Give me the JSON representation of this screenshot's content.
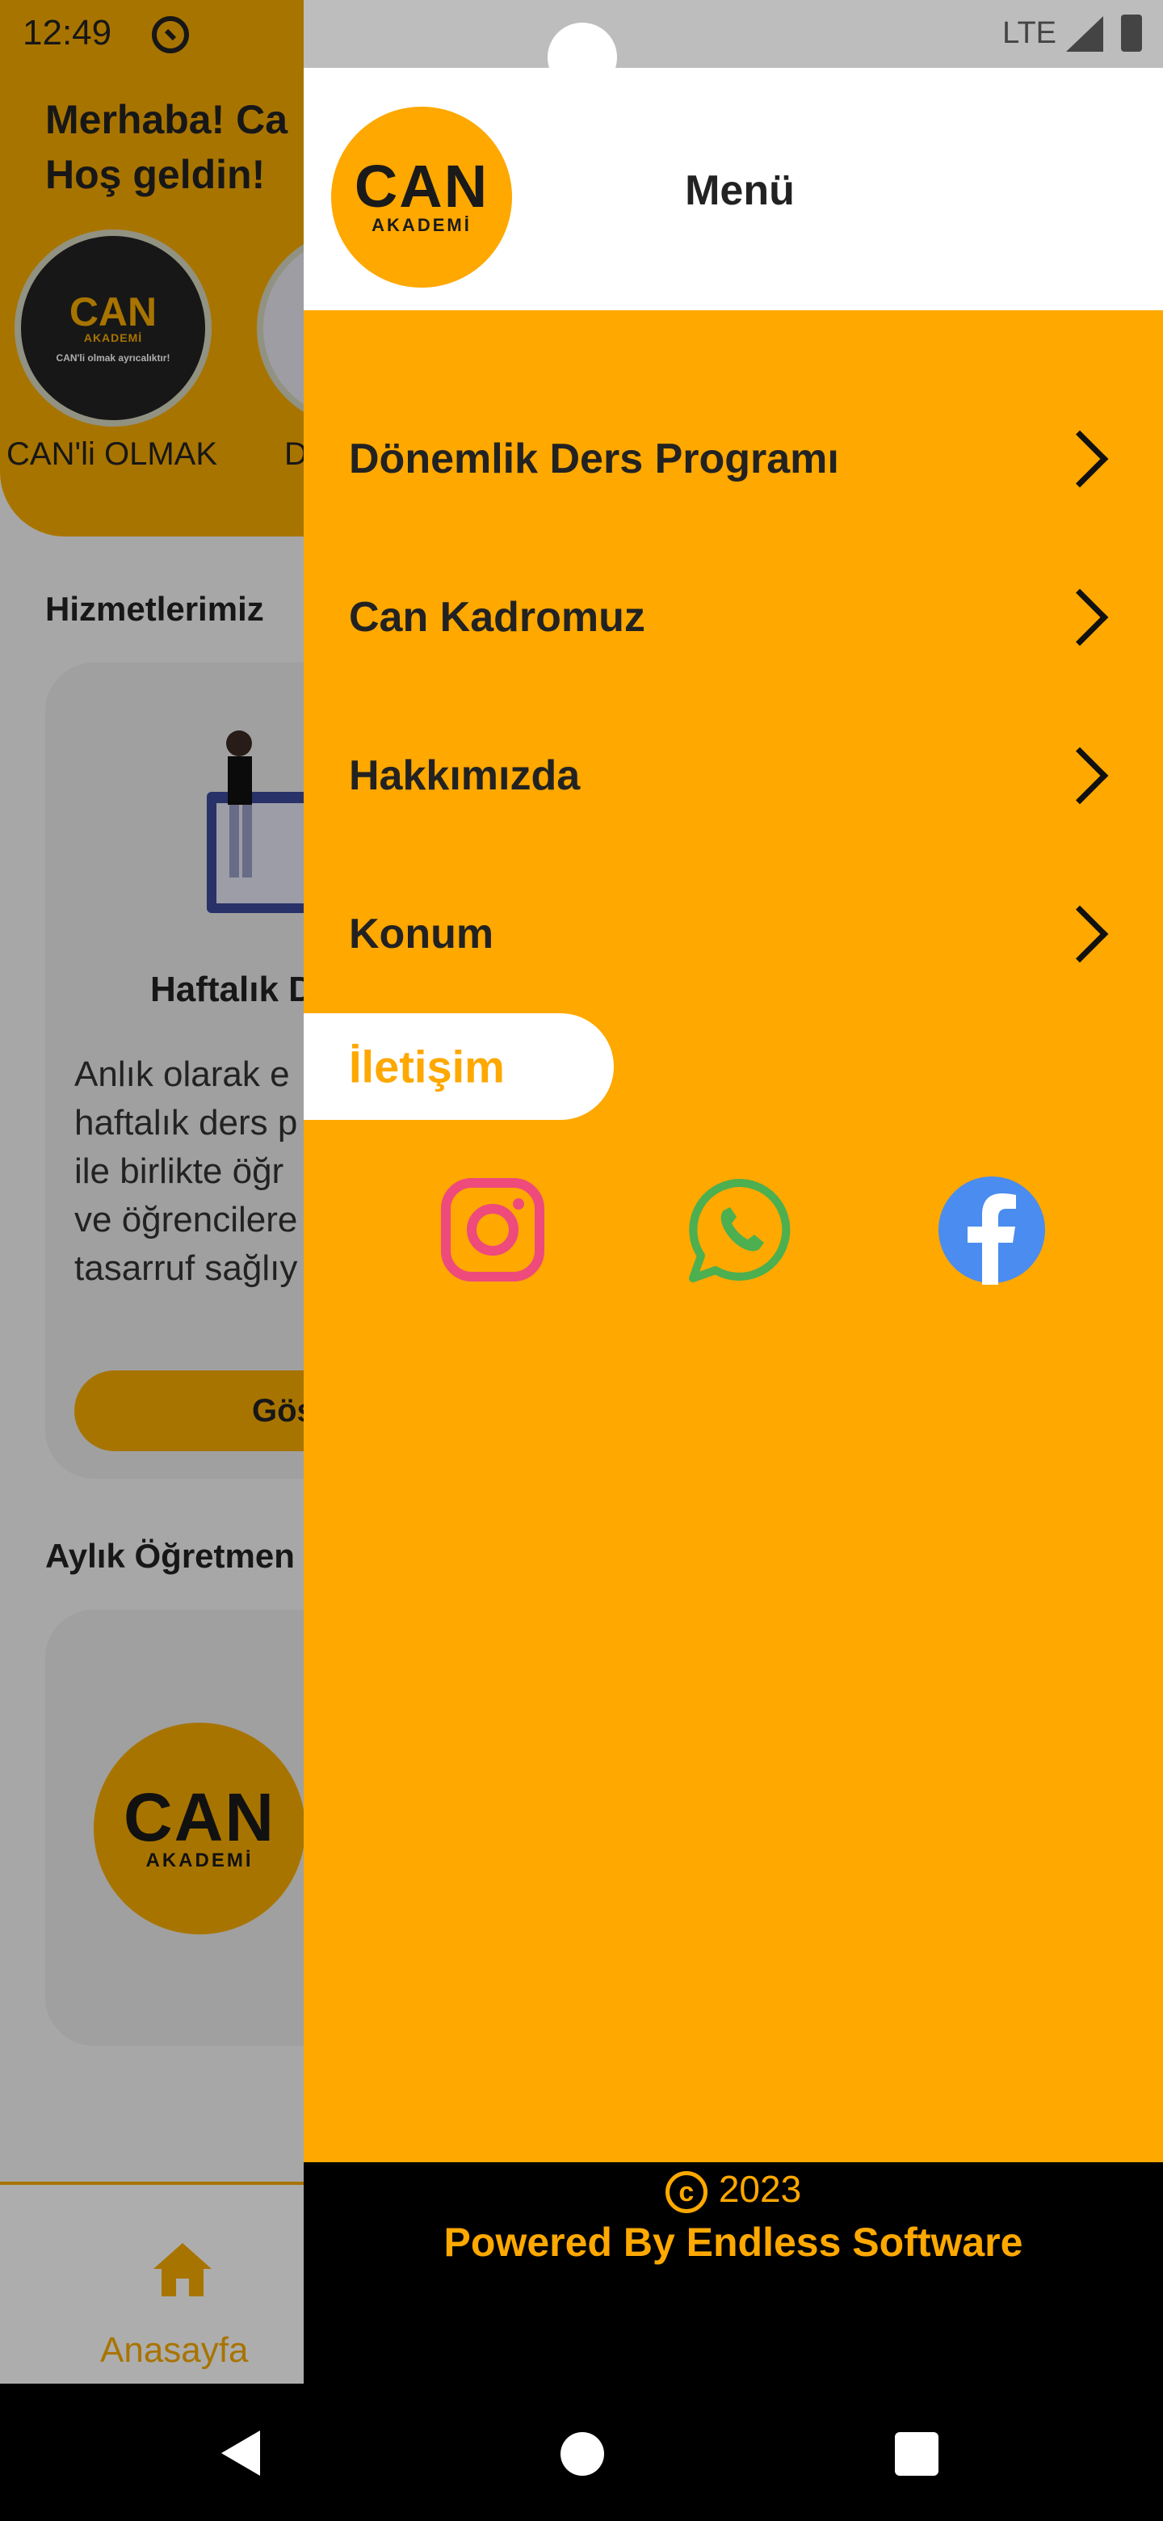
{
  "status_bar": {
    "time": "12:49",
    "network": "LTE"
  },
  "background": {
    "greeting_line1": "Merhaba! Ca",
    "greeting_line2": "Hoş geldin!",
    "story_label_1": "CAN'li OLMAK",
    "story_label_2": "D",
    "story_logo": "CAN",
    "story_logo_sub": "AKADEMİ",
    "story_caption": "CAN'li olmak ayrıcalıktır!",
    "services_title": "Hizmetlerimiz",
    "card_title": "Haftalık D",
    "card_text": "Anlık olarak e\nhaftalık ders p\nile birlikte öğr\nve öğrencilere\ntasarruf sağlıy",
    "card_button": "Gös",
    "monthly_title": "Aylık Öğretmen",
    "logo_main": "CAN",
    "logo_sub": "AKADEMİ",
    "nav_home_label": "Anasayfa"
  },
  "drawer": {
    "logo_main": "CAN",
    "logo_sub": "AKADEMİ",
    "title": "Menü",
    "items": [
      {
        "label": "Dönemlik Ders Programı"
      },
      {
        "label": "Can Kadromuz"
      },
      {
        "label": "Hakkımızda"
      },
      {
        "label": "Konum"
      }
    ],
    "active_item": {
      "label": "İletişim"
    },
    "social": [
      {
        "name": "instagram-icon",
        "color": "#ee4a7c"
      },
      {
        "name": "whatsapp-icon",
        "color": "#4caf50"
      },
      {
        "name": "facebook-icon",
        "color": "#4a8cf0"
      }
    ],
    "footer": {
      "copyright_symbol": "c",
      "year": "2023",
      "powered_by": "Powered By Endless Software"
    }
  },
  "colors": {
    "accent": "#fea800",
    "drawer_footer": "#000000",
    "text": "#222222"
  }
}
